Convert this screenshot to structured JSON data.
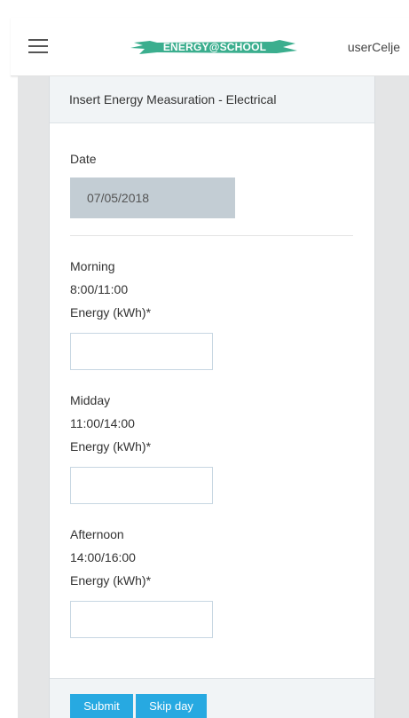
{
  "header": {
    "logo_text": "ENERGY@SCHOOL",
    "user": "userCelje",
    "logo_color": "#3bae8e"
  },
  "panel": {
    "title": "Insert Energy Measuration - Electrical",
    "date_label": "Date",
    "date_value": "07/05/2018",
    "periods": [
      {
        "name": "Morning",
        "time": "8:00/11:00",
        "energy_label": "Energy (kWh)*",
        "value": ""
      },
      {
        "name": "Midday",
        "time": "11:00/14:00",
        "energy_label": "Energy (kWh)*",
        "value": ""
      },
      {
        "name": "Afternoon",
        "time": "14:00/16:00",
        "energy_label": "Energy (kWh)*",
        "value": ""
      }
    ]
  },
  "footer": {
    "submit_label": "Submit",
    "skip_label": "Skip day",
    "button_color": "#27a9e1"
  }
}
